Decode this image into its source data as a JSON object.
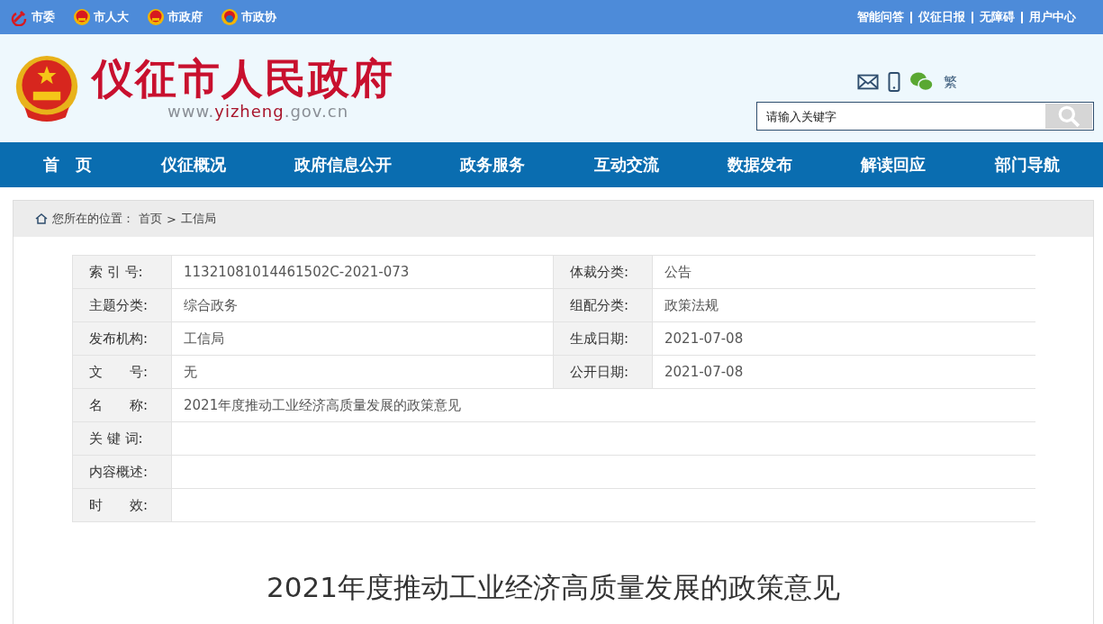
{
  "top_bar": {
    "left_links": [
      {
        "label": "市委",
        "kind": "party"
      },
      {
        "label": "市人大",
        "kind": "emblem"
      },
      {
        "label": "市政府",
        "kind": "emblem"
      },
      {
        "label": "市政协",
        "kind": "cppcc"
      }
    ],
    "right_links": [
      "智能问答",
      "仪征日报",
      "无障碍",
      "用户中心"
    ]
  },
  "header": {
    "site_name": "仪征市人民政府",
    "url_parts": [
      "www.",
      "yizheng",
      ".gov.cn"
    ],
    "traditional_toggle": "繁",
    "search": {
      "placeholder": "请输入关键字"
    }
  },
  "nav": [
    "首　页",
    "仪征概况",
    "政府信息公开",
    "政务服务",
    "互动交流",
    "数据发布",
    "解读回应",
    "部门导航"
  ],
  "breadcrumb": {
    "prefix": "您所在的位置：",
    "items": [
      "首页",
      "工信局"
    ],
    "separator": ">"
  },
  "info_table": [
    {
      "kind": "pair",
      "cells": [
        {
          "label": "索 引 号:",
          "value": "11321081014461502C-2021-073"
        },
        {
          "label": "体裁分类:",
          "value": "公告"
        }
      ]
    },
    {
      "kind": "pair",
      "cells": [
        {
          "label": "主题分类:",
          "value": "综合政务"
        },
        {
          "label": "组配分类:",
          "value": "政策法规"
        }
      ]
    },
    {
      "kind": "pair",
      "cells": [
        {
          "label": "发布机构:",
          "value": "工信局"
        },
        {
          "label": "生成日期:",
          "value": "2021-07-08"
        }
      ]
    },
    {
      "kind": "pair",
      "cells": [
        {
          "label": "文　　号:",
          "value": "无"
        },
        {
          "label": "公开日期:",
          "value": "2021-07-08"
        }
      ]
    },
    {
      "kind": "full",
      "cells": [
        {
          "label": "名　　称:",
          "value": "2021年度推动工业经济高质量发展的政策意见"
        }
      ]
    },
    {
      "kind": "full",
      "cells": [
        {
          "label": "关 键 词:"
        }
      ]
    },
    {
      "kind": "full",
      "cells": [
        {
          "label": "内容概述:"
        }
      ]
    },
    {
      "kind": "full",
      "cells": [
        {
          "label": "时　　效:"
        }
      ]
    }
  ],
  "article": {
    "title": "2021年度推动工业经济高质量发展的政策意见"
  }
}
